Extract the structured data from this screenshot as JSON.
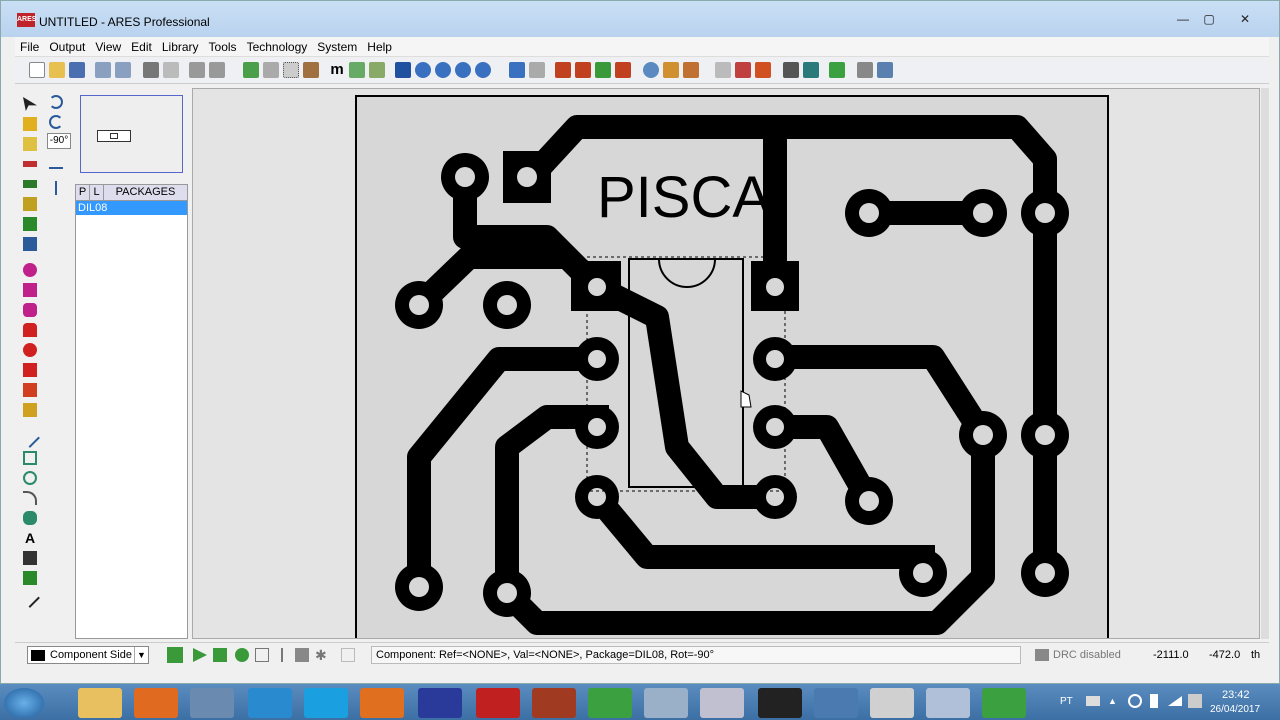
{
  "window": {
    "title": "UNTITLED - ARES Professional",
    "app_icon_text": "ARES",
    "minimize": "—",
    "maximize": "▢",
    "close": "✕"
  },
  "menu": [
    "File",
    "Output",
    "View",
    "Edit",
    "Library",
    "Tools",
    "Technology",
    "System",
    "Help"
  ],
  "rotation_value": "-90°",
  "packages": {
    "tab_p": "P",
    "tab_l": "L",
    "tab_title": "PACKAGES",
    "selected": "DIL08"
  },
  "board": {
    "label": "PISCA"
  },
  "status": {
    "layer": "Component Side",
    "message": "Component:  Ref=<NONE>, Val=<NONE>, Package=DIL08, Rot=-90°",
    "drc": "DRC disabled",
    "x": "-2111.0",
    "y": "-472.0",
    "units": "th"
  },
  "tray": {
    "lang": "PT",
    "time": "23:42",
    "date": "26/04/2017"
  },
  "colors": {
    "selection": "#3399ff",
    "copper": "#000000",
    "board_bg": "#d7d7d7"
  }
}
